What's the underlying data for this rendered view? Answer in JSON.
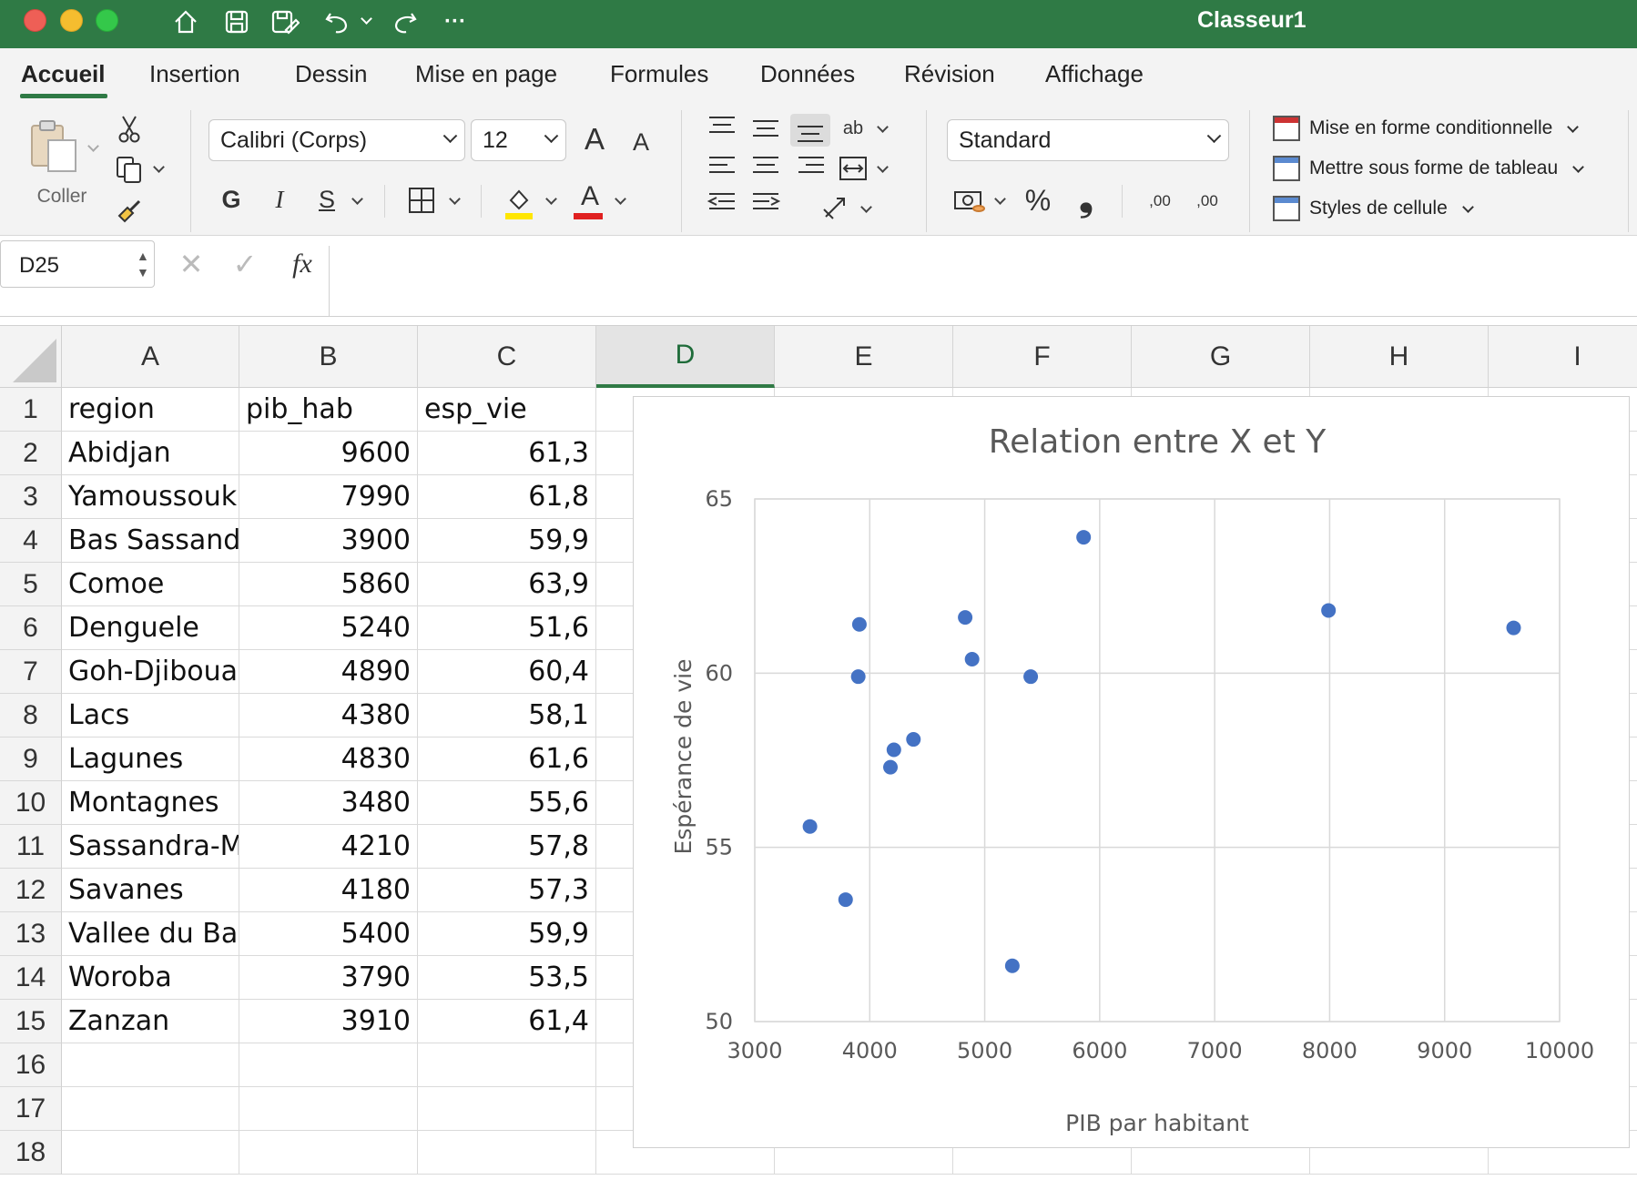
{
  "window": {
    "title": "Classeur1",
    "colors": {
      "titlebar": "#2f7a45",
      "accent": "#2f7a45",
      "marker": "#4472c4"
    }
  },
  "quick_access": [
    "home-icon",
    "save-icon",
    "save-as-icon",
    "undo-icon",
    "redo-icon",
    "more-icon"
  ],
  "quick_access_more": "···",
  "ribbon_tabs": [
    "Accueil",
    "Insertion",
    "Dessin",
    "Mise en page",
    "Formules",
    "Données",
    "Révision",
    "Affichage"
  ],
  "ribbon": {
    "paste_label": "Coller",
    "font_name": "Calibri (Corps)",
    "font_size": "12",
    "grow_font": "A",
    "shrink_font": "A",
    "bold": "G",
    "italic": "I",
    "underline": "S",
    "font_color_letter": "A",
    "number_format": "Standard",
    "percent": "%",
    "comma": "❟",
    "inc_decimal": ",00",
    "dec_decimal": ",00",
    "wrap_text": "ab",
    "styles": [
      "Mise en forme conditionnelle",
      "Mettre sous forme de tableau",
      "Styles de cellule"
    ]
  },
  "formula_bar": {
    "name_box": "D25",
    "fx": "fx",
    "formula": ""
  },
  "sheet": {
    "columns": [
      "A",
      "B",
      "C",
      "D",
      "E",
      "F",
      "G",
      "H",
      "I"
    ],
    "selected_column": "D",
    "row_numbers": [
      "1",
      "2",
      "3",
      "4",
      "5",
      "6",
      "7",
      "8",
      "9",
      "10",
      "11",
      "12",
      "13",
      "14",
      "15",
      "16",
      "17",
      "18"
    ],
    "rows": [
      [
        "region",
        "pib_hab",
        "esp_vie"
      ],
      [
        "Abidjan",
        "9600",
        "61,3"
      ],
      [
        "Yamoussoukro",
        "7990",
        "61,8"
      ],
      [
        "Bas Sassandra",
        "3900",
        "59,9"
      ],
      [
        "Comoe",
        "5860",
        "63,9"
      ],
      [
        "Denguele",
        "5240",
        "51,6"
      ],
      [
        "Goh-Djiboua",
        "4890",
        "60,4"
      ],
      [
        "Lacs",
        "4380",
        "58,1"
      ],
      [
        "Lagunes",
        "4830",
        "61,6"
      ],
      [
        "Montagnes",
        "3480",
        "55,6"
      ],
      [
        "Sassandra-Marahoue",
        "4210",
        "57,8"
      ],
      [
        "Savanes",
        "4180",
        "57,3"
      ],
      [
        "Vallee du Bandama",
        "5400",
        "59,9"
      ],
      [
        "Woroba",
        "3790",
        "53,5"
      ],
      [
        "Zanzan",
        "3910",
        "61,4"
      ]
    ]
  },
  "chart_data": {
    "type": "scatter",
    "title": "Relation entre X et Y",
    "xlabel": "PIB par habitant",
    "ylabel": "Espérance de vie",
    "xlim": [
      3000,
      10000
    ],
    "ylim": [
      50,
      65
    ],
    "xticks": [
      "3000",
      "4000",
      "5000",
      "6000",
      "7000",
      "8000",
      "9000",
      "10000"
    ],
    "yticks": [
      "50",
      "55",
      "60",
      "65"
    ],
    "grid": true,
    "legend": "none",
    "series": [
      {
        "x": [
          9600,
          7990,
          3900,
          5860,
          5240,
          4890,
          4380,
          4830,
          3480,
          4210,
          4180,
          5400,
          3790,
          3910
        ],
        "y": [
          61.3,
          61.8,
          59.9,
          63.9,
          51.6,
          60.4,
          58.1,
          61.6,
          55.6,
          57.8,
          57.3,
          59.9,
          53.5,
          61.4
        ]
      }
    ]
  }
}
